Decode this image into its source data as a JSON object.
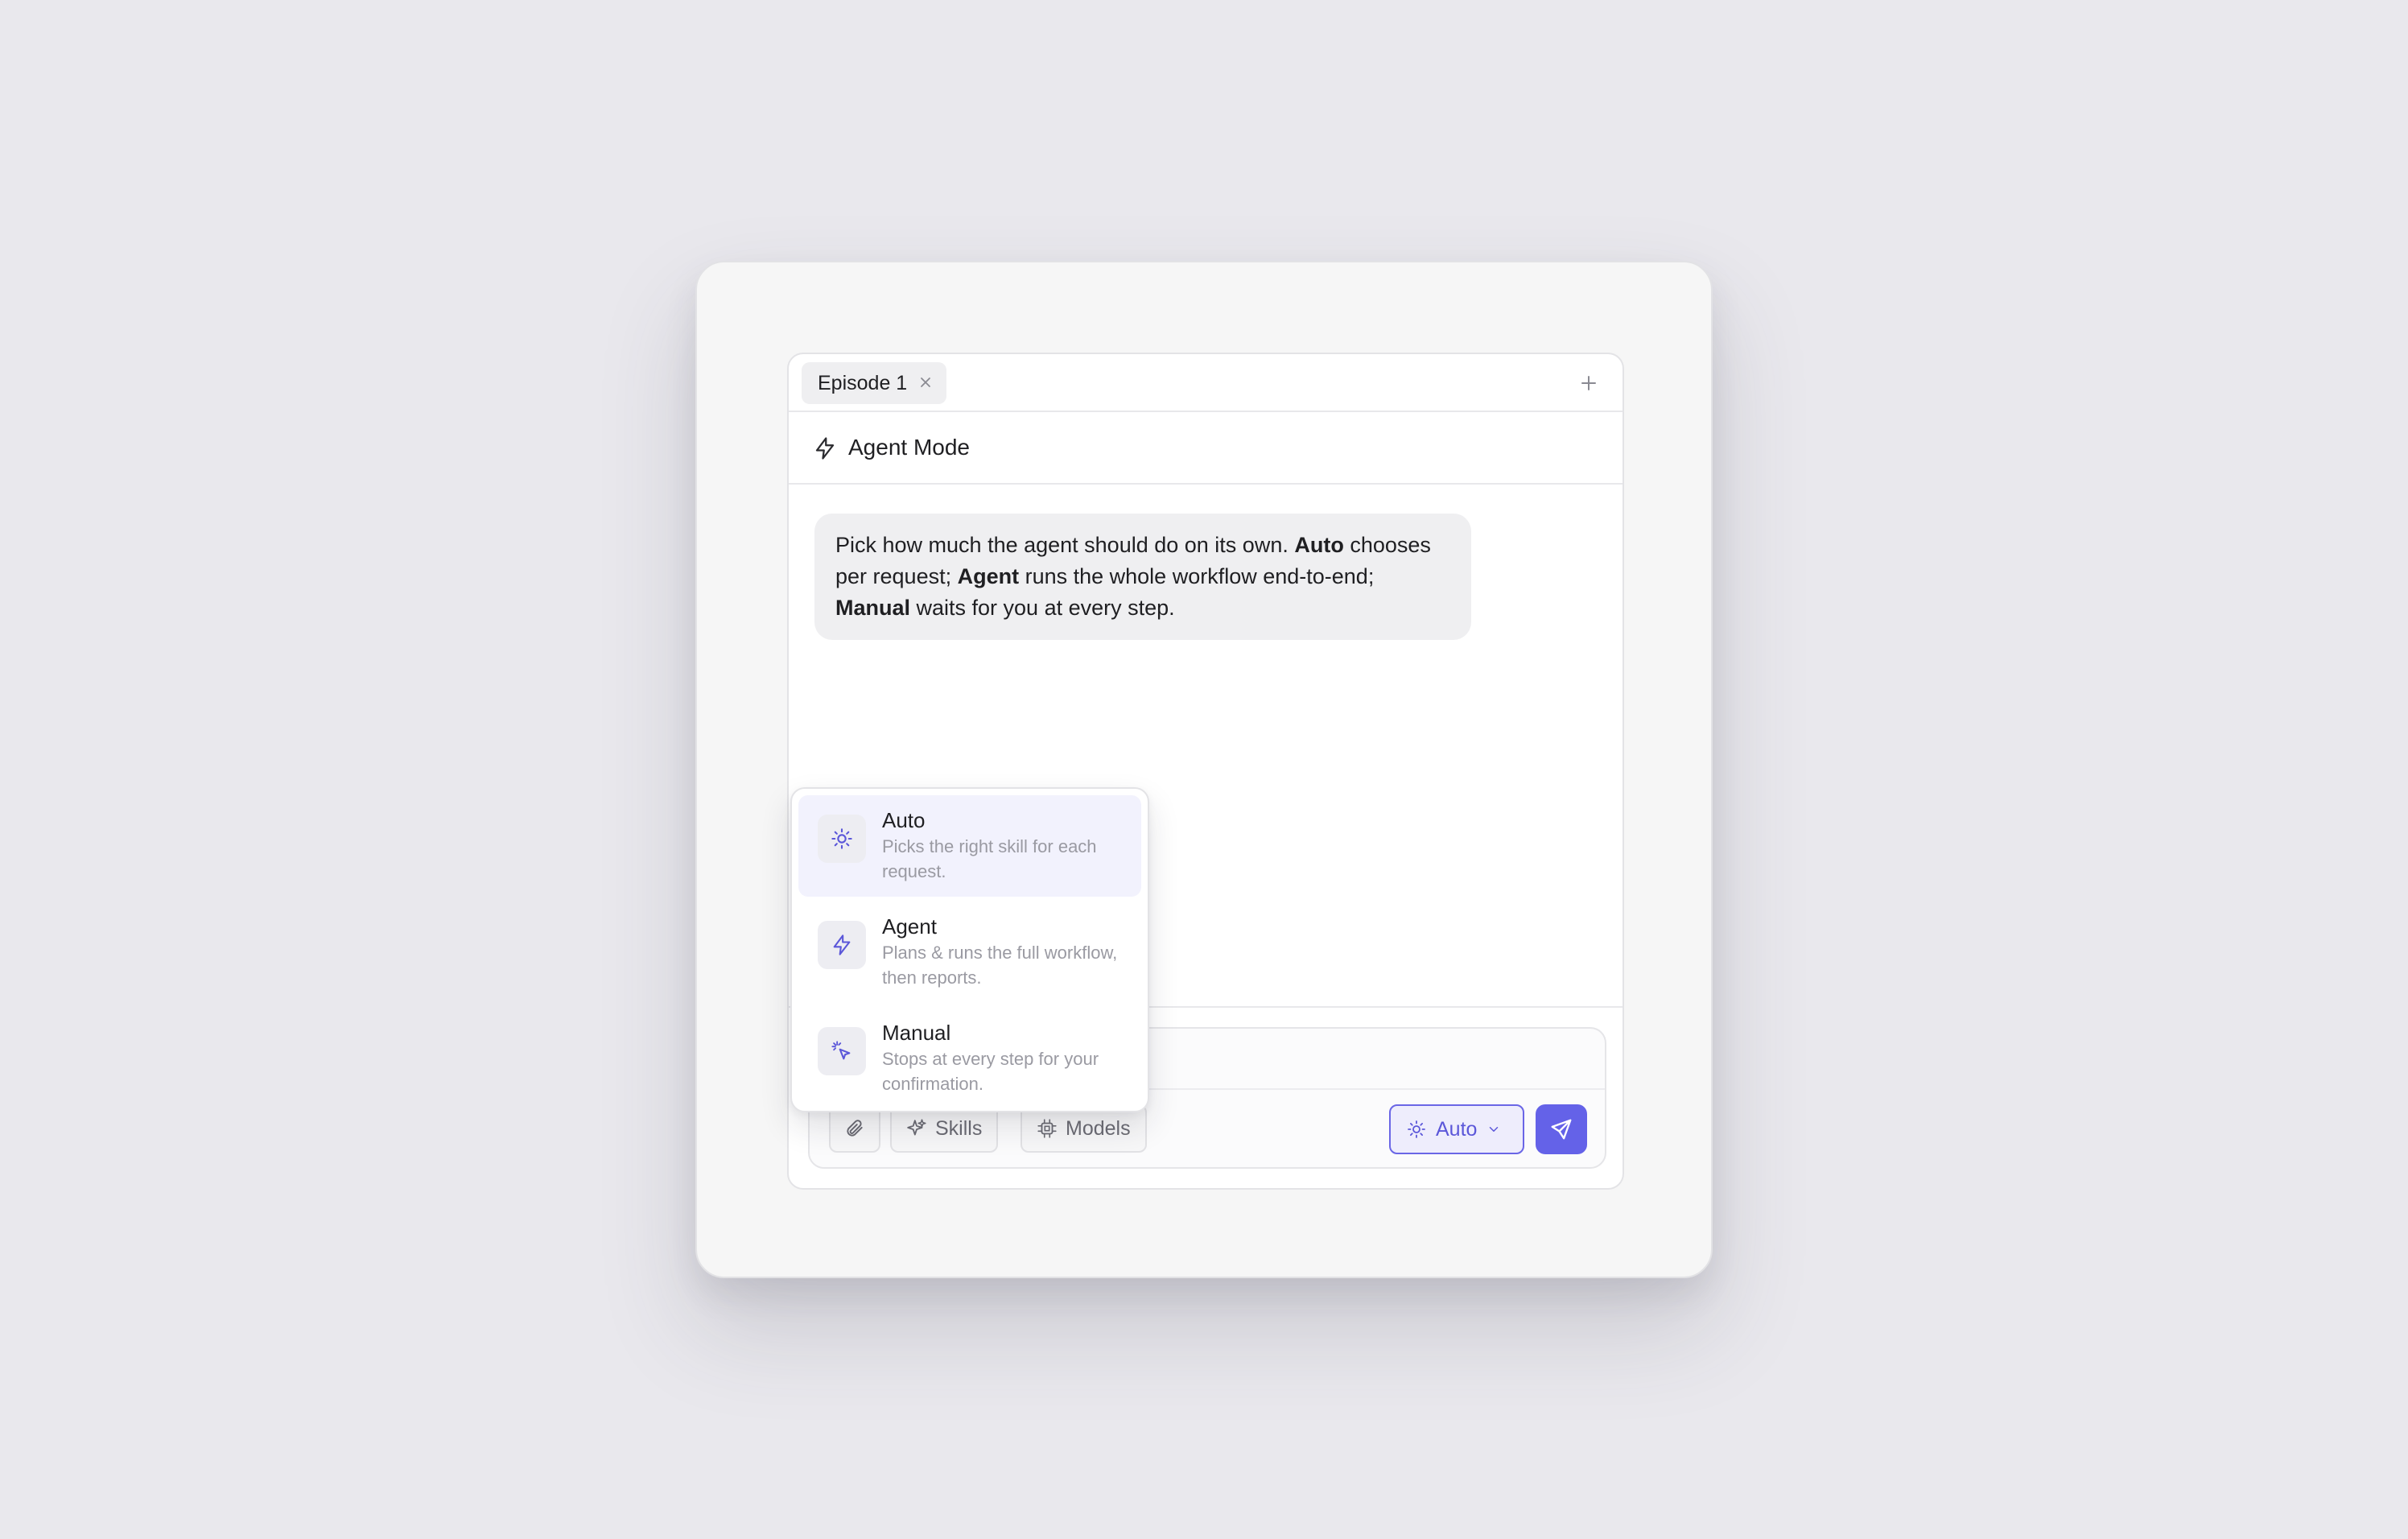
{
  "tabs": [
    {
      "label": "Episode 1",
      "active": true
    }
  ],
  "header": {
    "title": "Agent Mode",
    "icon": "bolt-icon"
  },
  "message": {
    "segments": [
      {
        "text": "Pick how much the agent should do on its own. ",
        "bold": false
      },
      {
        "text": "Auto",
        "bold": true
      },
      {
        "text": " chooses per request; ",
        "bold": false
      },
      {
        "text": "Agent",
        "bold": true
      },
      {
        "text": " runs the whole workflow end-to-end; ",
        "bold": false
      },
      {
        "text": "Manual",
        "bold": true
      },
      {
        "text": " waits for you at every step.",
        "bold": false
      }
    ]
  },
  "mode_menu": {
    "items": [
      {
        "label": "Auto",
        "description": "Picks the right skill for each request.",
        "icon": "sun-icon",
        "selected": true
      },
      {
        "label": "Agent",
        "description": "Plans & runs the full workflow, then reports.",
        "icon": "bolt-icon",
        "selected": false
      },
      {
        "label": "Manual",
        "description": "Stops at every step for your confirmation.",
        "icon": "cursor-click-icon",
        "selected": false
      }
    ]
  },
  "toolbar": {
    "attach_icon": "paperclip-icon",
    "skills_label": "Skills",
    "skills_icon": "sparkles-icon",
    "models_label": "Models",
    "models_icon": "chip-icon",
    "mode_label": "Auto",
    "mode_icon": "sun-icon",
    "send_icon": "send-icon"
  },
  "colors": {
    "accent": "#6462e8",
    "accent_text": "#5b57d9",
    "selected_bg": "#f2f2fd",
    "page_bg": "#e9e8ed"
  }
}
